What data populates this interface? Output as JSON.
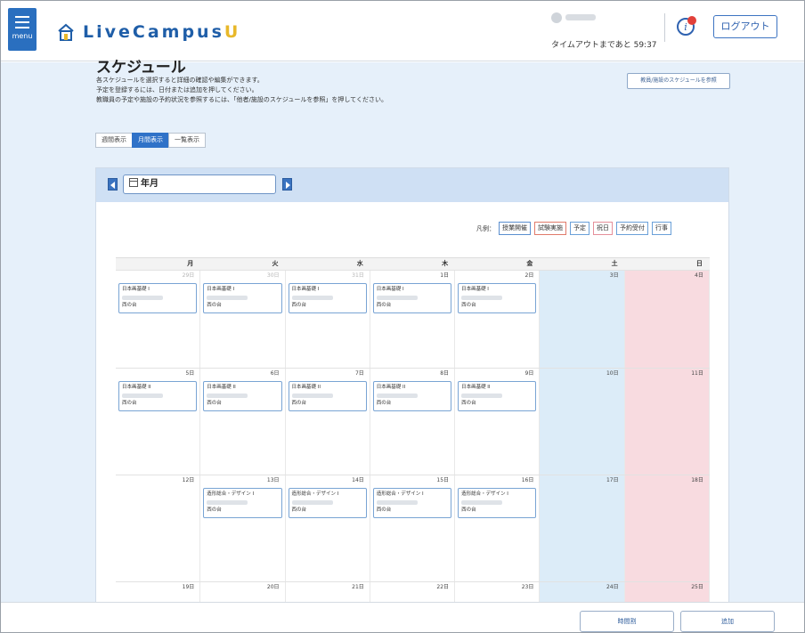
{
  "header": {
    "menu_label": "menu",
    "logo_text": "LiveCampus",
    "logo_suffix": "U",
    "timeout_text": "タイムアウトまであと 59:37",
    "logout_label": "ログアウト",
    "info_badge": "!"
  },
  "page": {
    "title": "スケジュール",
    "desc_lines": [
      "各スケジュールを選択すると詳細の確認や編集ができます。",
      "予定を登録するには、日付または追加を押してください。",
      "教職員の予定や施設の予約状況を参照するには、「他者/施設のスケジュールを参照」を押してください。"
    ],
    "ref_button": "教員/施設のスケジュールを参照",
    "view_tabs": [
      "週間表示",
      "月間表示",
      "一覧表示"
    ],
    "active_view": 1
  },
  "calendar": {
    "month_label": "年月",
    "legend_label": "凡例：",
    "legend": [
      {
        "label": "授業開催",
        "color": "#5b8fcf"
      },
      {
        "label": "試験実施",
        "color": "#e07a6a"
      },
      {
        "label": "予定",
        "color": "#6aa0d8"
      },
      {
        "label": "祝日",
        "color": "#e58f9a"
      },
      {
        "label": "予約受付",
        "color": "#6aa0d8"
      },
      {
        "label": "行事",
        "color": "#6aa0d8"
      }
    ],
    "weekdays": [
      "月",
      "火",
      "水",
      "木",
      "金",
      "土",
      "日"
    ],
    "weeks": [
      {
        "days": [
          "29日",
          "30日",
          "31日",
          "1日",
          "2日",
          "3日",
          "4日"
        ],
        "prev": [
          true,
          true,
          true,
          false,
          false,
          false,
          false
        ],
        "events": [
          {
            "title": "日本画基礎 I",
            "room": "西の台"
          },
          {
            "title": "日本画基礎 I",
            "room": "西の台"
          },
          {
            "title": "日本画基礎 I",
            "room": "西の台"
          },
          {
            "title": "日本画基礎 I",
            "room": "西の台"
          },
          {
            "title": "日本画基礎 I",
            "room": "西の台"
          },
          null,
          null
        ]
      },
      {
        "days": [
          "5日",
          "6日",
          "7日",
          "8日",
          "9日",
          "10日",
          "11日"
        ],
        "prev": [
          false,
          false,
          false,
          false,
          false,
          false,
          false
        ],
        "events": [
          {
            "title": "日本画基礎 II",
            "room": "西の台"
          },
          {
            "title": "日本画基礎 II",
            "room": "西の台"
          },
          {
            "title": "日本画基礎 II",
            "room": "西の台"
          },
          {
            "title": "日本画基礎 II",
            "room": "西の台"
          },
          {
            "title": "日本画基礎 II",
            "room": "西の台"
          },
          null,
          null
        ]
      },
      {
        "days": [
          "12日",
          "13日",
          "14日",
          "15日",
          "16日",
          "17日",
          "18日"
        ],
        "prev": [
          false,
          false,
          false,
          false,
          false,
          false,
          false
        ],
        "events": [
          null,
          {
            "title": "造形総合・デザイン I",
            "room": "西の台"
          },
          {
            "title": "造形総合・デザイン I",
            "room": "西の台"
          },
          {
            "title": "造形総合・デザイン I",
            "room": "西の台"
          },
          {
            "title": "造形総合・デザイン I",
            "room": "西の台"
          },
          null,
          null
        ]
      },
      {
        "days": [
          "19日",
          "20日",
          "21日",
          "22日",
          "23日",
          "24日",
          "25日"
        ],
        "prev": [
          false,
          false,
          false,
          false,
          false,
          false,
          false
        ],
        "events": [
          null,
          null,
          null,
          null,
          null,
          null,
          null
        ]
      }
    ]
  },
  "footer": {
    "timetable_label": "時間割",
    "add_label": "追加"
  },
  "colors": {
    "primary": "#2f72c8",
    "saturday": "#dcecf8",
    "sunday": "#f8dbe0",
    "background": "#e6f0fa"
  }
}
